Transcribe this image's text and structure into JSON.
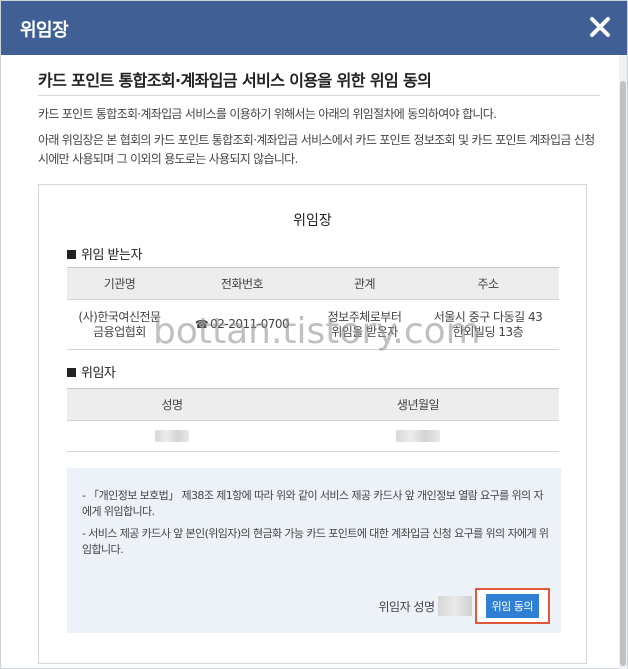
{
  "modal": {
    "title": "위임장",
    "close_icon": "close-icon"
  },
  "section": {
    "title": "카드 포인트 통합조회·계좌입금 서비스 이용을 위한 위임 동의",
    "intro_1": "카드 포인트 통합조회·계좌입금 서비스를 이용하기 위해서는 아래의 위임절차에 동의하여야 합니다.",
    "intro_2": "아래 위임장은 본 협회의 카드 포인트 통합조회·계좌입금 서비스에서 카드 포인트 정보조회 및 카드 포인트 계좌입금 신청 시에만 사용되며 그 이외의 용도로는 사용되지 않습니다."
  },
  "document": {
    "title": "위임장",
    "recipient_heading": "위임 받는자",
    "recipient_table": {
      "headers": [
        "기관명",
        "전화번호",
        "관계",
        "주소"
      ],
      "row": {
        "org_line1": "(사)한국여신전문",
        "org_line2": "금융업협회",
        "phone": "02-2011-0700",
        "relation_line1": "정보주체로부터",
        "relation_line2": "위임을 받은자",
        "address_line1": "서울시 중구 다동길 43",
        "address_line2": "한외빌딩 13층"
      }
    },
    "delegator_heading": "위임자",
    "delegator_table": {
      "headers": [
        "성명",
        "생년월일"
      ]
    }
  },
  "consent": {
    "bullet_1": "- 「개인정보 보호법」 제38조 제1항에 따라 위와 같이 서비스 제공 카드사 앞 개인정보 열람 요구를 위의 자에게 위임합니다.",
    "bullet_2": "- 서비스 제공 카드사 앞 본인(위임자)의 현금화 가능 카드 포인트에 대한 계좌입금 신청 요구를 위의 자에게 위임합니다.",
    "sign_label": "위임자 성명",
    "agree_button": "위임 동의"
  },
  "watermark": "bottan.tistory.com",
  "colors": {
    "header_bg": "#3f5f95",
    "agree_button_bg": "#2f7fd4",
    "highlight_border": "#e0573c",
    "consent_bg": "#edf1f8"
  }
}
